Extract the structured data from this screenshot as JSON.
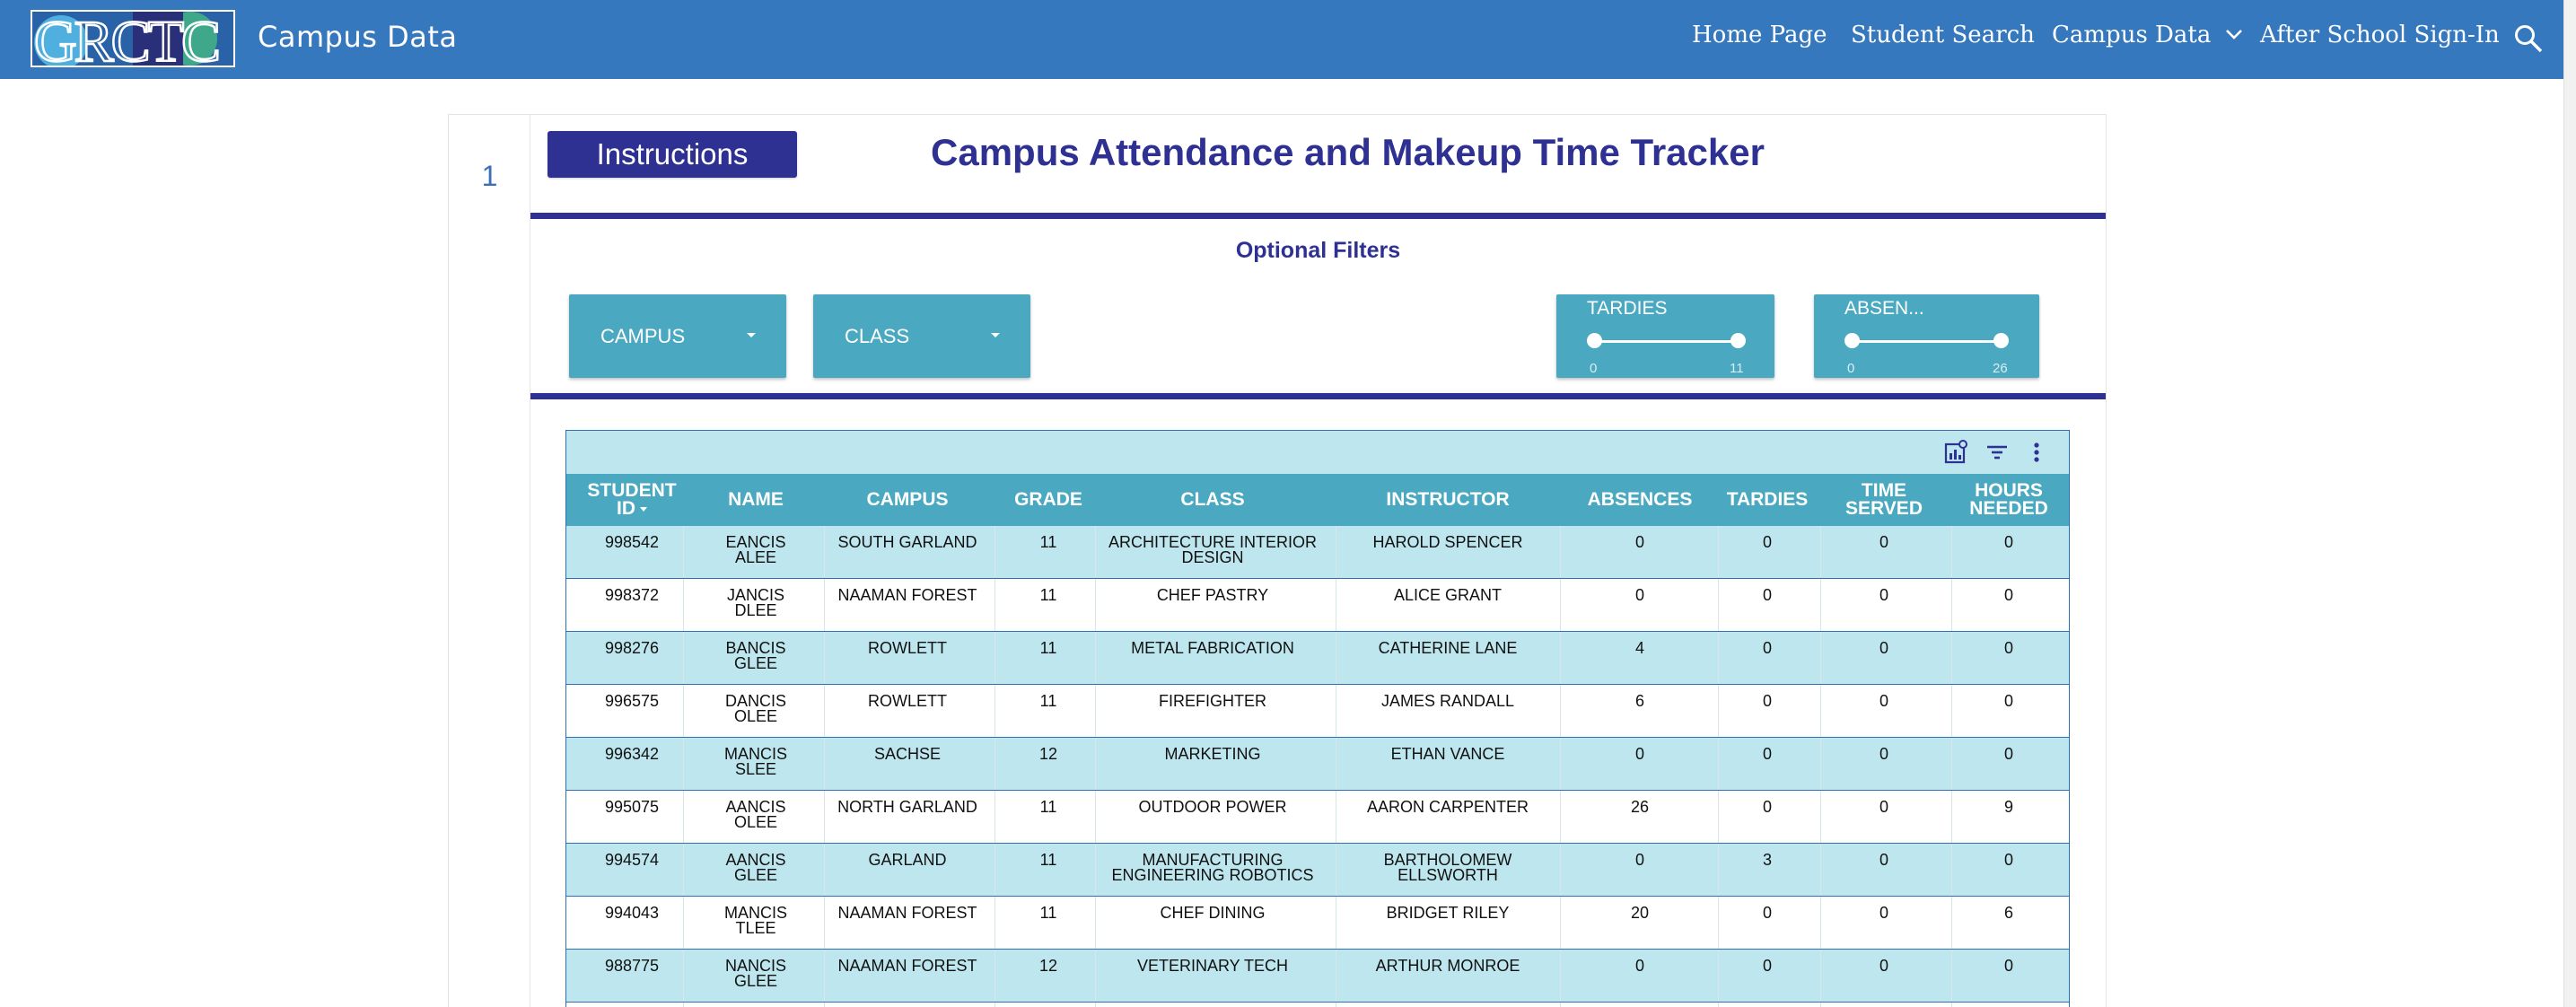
{
  "header": {
    "logo_text": "GRCTC",
    "site_title": "Campus Data",
    "nav": [
      {
        "label": "Home Page"
      },
      {
        "label": "Student Search"
      },
      {
        "label": "Campus Data"
      },
      {
        "label": "After School Sign-In"
      }
    ],
    "search_icon": "search-icon",
    "brand_color": "#3578be"
  },
  "report": {
    "page_number": "1",
    "instructions_label": "Instructions",
    "title": "Campus Attendance and Makeup Time Tracker",
    "optional_filters": "Optional Filters",
    "accent_color": "#2e3192",
    "filters": {
      "campus": "CAMPUS",
      "class": "CLASS",
      "tardies": {
        "label": "TARDIES",
        "min": "0",
        "max": "11"
      },
      "absences": {
        "label": "ABSEN...",
        "min": "0",
        "max": "26"
      }
    }
  },
  "table": {
    "tool_icons": [
      "chart-icon",
      "filter-icon",
      "more-vert-icon"
    ],
    "columns": [
      {
        "line1": "STUDENT",
        "line2": "ID"
      },
      {
        "line1": "NAME",
        "line2": ""
      },
      {
        "line1": "CAMPUS",
        "line2": ""
      },
      {
        "line1": "GRADE",
        "line2": ""
      },
      {
        "line1": "CLASS",
        "line2": ""
      },
      {
        "line1": "INSTRUCTOR",
        "line2": ""
      },
      {
        "line1": "ABSENCES",
        "line2": ""
      },
      {
        "line1": "TARDIES",
        "line2": ""
      },
      {
        "line1": "TIME",
        "line2": "SERVED"
      },
      {
        "line1": "HOURS",
        "line2": "NEEDED"
      }
    ],
    "rows": [
      [
        "998542",
        "EANCIS|ALEE",
        "SOUTH GARLAND",
        "11",
        "ARCHITECTURE INTERIOR|DESIGN",
        "HAROLD SPENCER",
        "0",
        "0",
        "0",
        "0"
      ],
      [
        "998372",
        "JANCIS|DLEE",
        "NAAMAN FOREST",
        "11",
        "CHEF PASTRY",
        "ALICE GRANT",
        "0",
        "0",
        "0",
        "0"
      ],
      [
        "998276",
        "BANCIS|GLEE",
        "ROWLETT",
        "11",
        "METAL FABRICATION",
        "CATHERINE LANE",
        "4",
        "0",
        "0",
        "0"
      ],
      [
        "996575",
        "DANCIS|OLEE",
        "ROWLETT",
        "11",
        "FIREFIGHTER",
        "JAMES RANDALL",
        "6",
        "0",
        "0",
        "0"
      ],
      [
        "996342",
        "MANCIS|SLEE",
        "SACHSE",
        "12",
        "MARKETING",
        "ETHAN VANCE",
        "0",
        "0",
        "0",
        "0"
      ],
      [
        "995075",
        "AANCIS|OLEE",
        "NORTH GARLAND",
        "11",
        "OUTDOOR POWER",
        "AARON CARPENTER",
        "26",
        "0",
        "0",
        "9"
      ],
      [
        "994574",
        "AANCIS|GLEE",
        "GARLAND",
        "11",
        "MANUFACTURING|ENGINEERING ROBOTICS",
        "BARTHOLOMEW|ELLSWORTH",
        "0",
        "3",
        "0",
        "0"
      ],
      [
        "994043",
        "MANCIS|TLEE",
        "NAAMAN FOREST",
        "11",
        "CHEF DINING",
        "BRIDGET RILEY",
        "20",
        "0",
        "0",
        "6"
      ],
      [
        "988775",
        "NANCIS|GLEE",
        "NAAMAN FOREST",
        "12",
        "VETERINARY TECH",
        "ARTHUR MONROE",
        "0",
        "0",
        "0",
        "0"
      ],
      [
        "",
        "",
        "",
        "",
        "",
        "",
        "",
        "",
        "",
        ""
      ]
    ]
  }
}
